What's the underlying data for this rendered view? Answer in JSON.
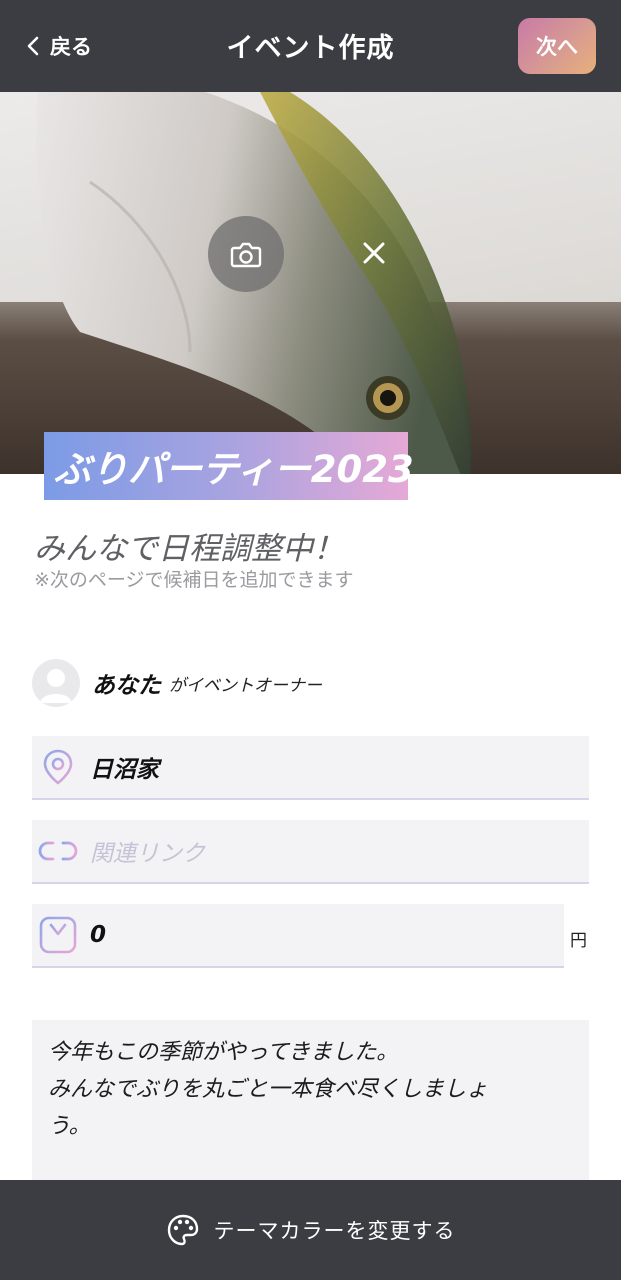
{
  "header": {
    "back_label": "戻る",
    "title": "イベント作成",
    "next_label": "次へ"
  },
  "cover": {
    "camera_icon": "camera-icon",
    "close_icon": "close-icon"
  },
  "event": {
    "title": "ぶりパーティー2023",
    "subtitle": "みんなで日程調整中！",
    "note": "※次のページで候補日を追加できます"
  },
  "owner": {
    "name": "あなた",
    "suffix": "がイベントオーナー"
  },
  "fields": {
    "location_value": "日沼家",
    "link_placeholder": "関連リンク",
    "price_value": "0",
    "price_unit": "円"
  },
  "description": {
    "lines": [
      "今年もこの季節がやってきました。",
      "みんなでぶりを丸ごと一本食べ尽くしましょ",
      "う。"
    ]
  },
  "bottom": {
    "theme_label": "テーマカラーを変更する",
    "icon": "palette-icon"
  },
  "colors": {
    "header_bg": "#3b3d42",
    "accent_gradient_start": "#7c9be6",
    "accent_gradient_end": "#e5a9d6",
    "field_bg": "#f3f3f6"
  }
}
